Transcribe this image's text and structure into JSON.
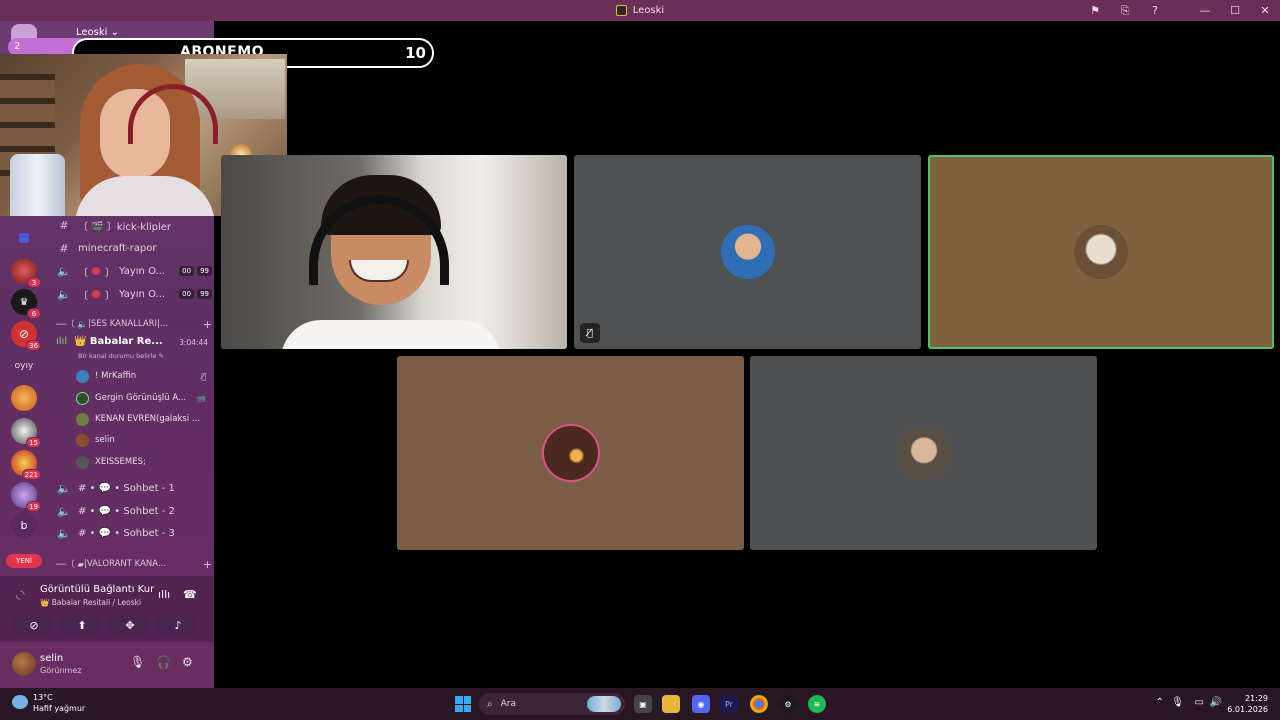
{
  "window": {
    "title": "Leoski",
    "controls": [
      "flag-icon",
      "cast-icon",
      "help-icon",
      "minimize-icon",
      "maximize-icon",
      "close-icon"
    ]
  },
  "server": {
    "name": "Leoski ⌄"
  },
  "servers": [
    {
      "name": "server-red",
      "color": "#b83b3b",
      "badge": "3"
    },
    {
      "name": "server-crown",
      "color": "#1a1a1a",
      "badge": "6"
    },
    {
      "name": "server-nosign",
      "color": "#d13333",
      "badge": "36"
    },
    {
      "name": "server-text",
      "label": "oyıy"
    },
    {
      "name": "server-orange",
      "color": "#e4832b",
      "badge": ""
    },
    {
      "name": "server-anime",
      "color": "#dcdcdc",
      "badge": "15"
    },
    {
      "name": "server-yellow",
      "color": "#d4a017",
      "badge": "221"
    },
    {
      "name": "server-purple",
      "color": "#8e63b8",
      "badge": "19"
    },
    {
      "name": "server-b",
      "label": "b"
    }
  ],
  "new_label": "YENİ",
  "channels": {
    "text": [
      {
        "label": "〔 🎬 〕kick-klipler"
      },
      {
        "label": "minecraft-rapor"
      }
    ],
    "live": [
      {
        "label": "Yayın O...",
        "count_a": "00",
        "count_b": "99"
      },
      {
        "label": "Yayın O...",
        "count_a": "00",
        "count_b": "99"
      }
    ],
    "category_voice": "|SES KANALLARI|...",
    "active_voice": {
      "name": "👑 Babalar Re...",
      "time": "3:04:44",
      "status": "Bir kanal durumu belirle ✎"
    },
    "voice_users": [
      {
        "name": "! MrKaffin",
        "trail": "🎙̸",
        "color": "#3f7fbf"
      },
      {
        "name": "Gergin Görünüşlü A...",
        "trail": "📹",
        "color": "#2f4f2f"
      },
      {
        "name": "KENAN EVREN(galaksi ...",
        "trail": "",
        "color": "#6f7f3f"
      },
      {
        "name": "selin",
        "trail": "",
        "color": "#8a4f2f"
      },
      {
        "name": "XEISSEMES;",
        "trail": "",
        "color": "#555555"
      }
    ],
    "chat_channels": [
      {
        "label": "# • 💬 • Sohbet - 1"
      },
      {
        "label": "# • 💬 • Sohbet - 2"
      },
      {
        "label": "# • 💬 • Sohbet - 3"
      }
    ],
    "category_valorant": "|VALORANT KANA..."
  },
  "voice_panel": {
    "title": "Görüntülü Bağlantı Kur",
    "subtitle": "👑 Babalar Resitali / Leoski"
  },
  "user_panel": {
    "name": "selin",
    "status": "Görünmez"
  },
  "overlay": {
    "sub_label": "ABONEMO",
    "sub_count": "10",
    "pill": "2"
  },
  "tiles": [
    {
      "name": "tile-camera-guy",
      "speaking": true,
      "muted": false,
      "bg": ""
    },
    {
      "name": "tile-mrkaffin",
      "speaking": false,
      "muted": true,
      "bg": "#505153"
    },
    {
      "name": "tile-cat",
      "speaking": true,
      "muted": false,
      "bg": "#7e6240"
    },
    {
      "name": "tile-selin",
      "speaking": false,
      "muted": false,
      "bg": "#7b5e45"
    },
    {
      "name": "tile-kenan",
      "speaking": false,
      "muted": false,
      "bg": "#4f5051"
    }
  ],
  "taskbar": {
    "weather_temp": "13°C",
    "weather_desc": "Hafif yağmur",
    "search_placeholder": "Ara",
    "time": "21:29",
    "date": "6.01.2026"
  }
}
